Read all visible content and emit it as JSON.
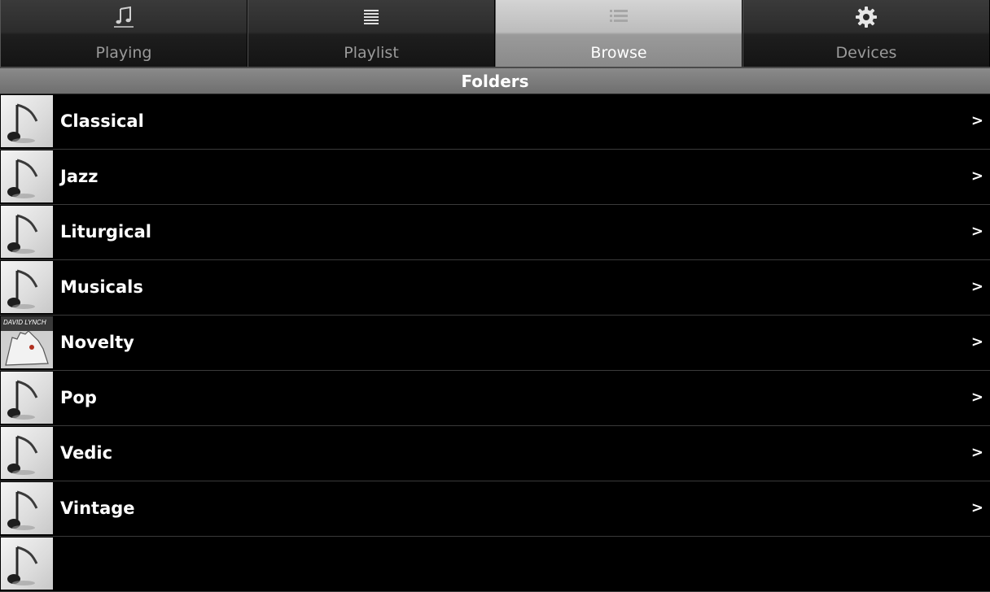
{
  "tabs": [
    {
      "label": "Playing",
      "icon": "music-note-icon",
      "active": false
    },
    {
      "label": "Playlist",
      "icon": "playlist-lines-icon",
      "active": false
    },
    {
      "label": "Browse",
      "icon": "list-icon",
      "active": true
    },
    {
      "label": "Devices",
      "icon": "gear-icon",
      "active": false
    }
  ],
  "header": {
    "title": "Folders"
  },
  "folders": [
    {
      "name": "Classical",
      "chevron": ">",
      "thumb": "music-note-icon"
    },
    {
      "name": "Jazz",
      "chevron": ">",
      "thumb": "music-note-icon"
    },
    {
      "name": "Liturgical",
      "chevron": ">",
      "thumb": "music-note-icon"
    },
    {
      "name": "Musicals",
      "chevron": ">",
      "thumb": "music-note-icon"
    },
    {
      "name": "Novelty",
      "chevron": ">",
      "thumb": "album-cover",
      "cover_text": "DAVID LYNCH"
    },
    {
      "name": "Pop",
      "chevron": ">",
      "thumb": "music-note-icon"
    },
    {
      "name": "Vedic",
      "chevron": ">",
      "thumb": "music-note-icon"
    },
    {
      "name": "Vintage",
      "chevron": ">",
      "thumb": "music-note-icon"
    },
    {
      "name": "",
      "chevron": "",
      "thumb": "music-note-icon"
    }
  ],
  "colors": {
    "active_tab": "#a8a8a8",
    "header_bg": "#7a7a7a",
    "list_bg": "#000000"
  }
}
